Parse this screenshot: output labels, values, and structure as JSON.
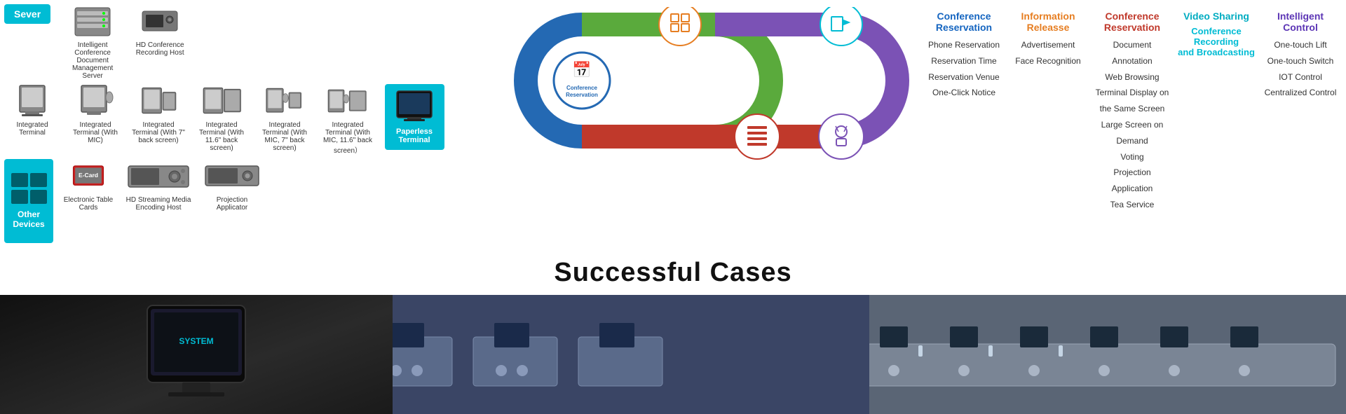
{
  "server": {
    "label": "Sever",
    "items": [
      {
        "name": "Intelligent Conference Document Management Server",
        "icon": "server"
      },
      {
        "name": "HD Conference Recording Host",
        "icon": "recording-host"
      }
    ]
  },
  "devices": [
    {
      "name": "Integrated Terminal",
      "icon": "terminal"
    },
    {
      "name": "Integrated Terminal (With MIC)",
      "icon": "terminal-mic"
    },
    {
      "name": "Integrated Terminal (With 7\" back screen)",
      "icon": "terminal-7"
    },
    {
      "name": "Integrated Terminal (With 11.6\" back screen)",
      "icon": "terminal-11"
    },
    {
      "name": "Integrated Terminal (With MIC, 7\" back screen)",
      "icon": "terminal-mic-7"
    },
    {
      "name": "Integrated Terminal (With MIC, 11.6\" back screen)",
      "icon": "terminal-mic-11"
    },
    {
      "name": "Paperless Terminal",
      "icon": "paperless",
      "highlight": true
    }
  ],
  "otherDevices": {
    "label": "Other Devices",
    "items": [
      {
        "name": "Electronic Table Cards",
        "icon": "table-card"
      },
      {
        "name": "HD Streaming Media Encoding Host",
        "icon": "encoding"
      },
      {
        "name": "Projection Applicator",
        "icon": "projector"
      }
    ]
  },
  "diagram": {
    "features": [
      {
        "name": "Conference Reservation",
        "color": "#1565c0",
        "items": [
          "Phone Reservation",
          "Reservation Time",
          "Reservation Venue",
          "One-Click Notice"
        ]
      },
      {
        "name": "Information Release",
        "color": "#e67e22",
        "items": [
          "Advertisement",
          "Face Recognition"
        ]
      },
      {
        "name": "Conference Reservation",
        "color": "#c0392b",
        "items": [
          "Document Annotation",
          "Web Browsing",
          "Terminal Display on the Same Screen",
          "Large Screen on Demand",
          "Voting",
          "Projection Application",
          "Tea Service"
        ]
      },
      {
        "name": "Video Sharing",
        "color": "#00acc1",
        "subname": "Conference Recording and Broadcasting",
        "items": []
      },
      {
        "name": "Intelligent Control",
        "color": "#5c35b5",
        "items": [
          "One-touch Lift",
          "One-touch Switch",
          "IOT Control",
          "Centralized Control"
        ]
      }
    ]
  },
  "successfulCases": {
    "title": "Successful Cases"
  }
}
